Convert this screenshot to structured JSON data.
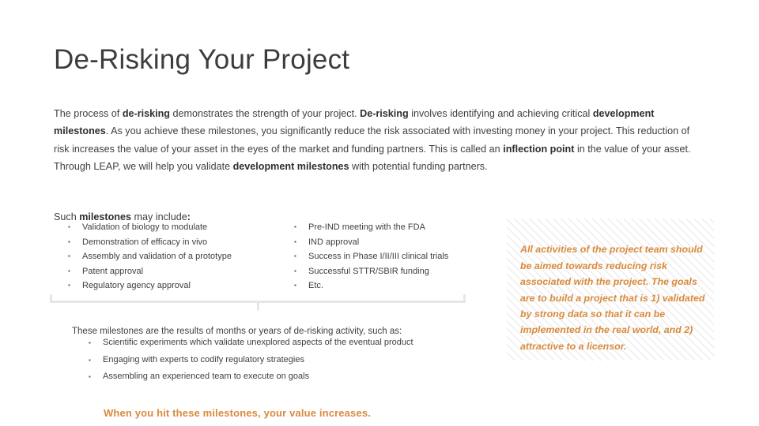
{
  "slide": {
    "title": "De-Risking Your Project",
    "intro": {
      "segments": [
        {
          "text": "The process of ",
          "bold": false
        },
        {
          "text": "de-risking",
          "bold": true
        },
        {
          "text": " demonstrates the strength of your project. ",
          "bold": false
        },
        {
          "text": "De-risking",
          "bold": true
        },
        {
          "text": " involves identifying and achieving critical ",
          "bold": false
        },
        {
          "text": "development milestones",
          "bold": true
        },
        {
          "text": ". As you achieve these milestones, you significantly reduce the risk associated with investing money in your project. This reduction of risk increases the value of your asset in the eyes of the market and funding partners. This is called an ",
          "bold": false
        },
        {
          "text": "inflection point",
          "bold": true
        },
        {
          "text": " in the value of your asset. Through LEAP, we will help you validate ",
          "bold": false
        },
        {
          "text": "development milestones",
          "bold": true
        },
        {
          "text": " with potential funding partners.",
          "bold": false
        }
      ]
    },
    "lead_in": {
      "segments": [
        {
          "text": "Such ",
          "bold": false
        },
        {
          "text": "milestones",
          "bold": true
        },
        {
          "text": " may include",
          "bold": false
        },
        {
          "text": ":",
          "bold": true
        }
      ]
    },
    "bullet_char": "▪",
    "milestones_left": [
      "Validation of biology to modulate",
      "Demonstration of efficacy in vivo",
      "Assembly and validation of a prototype",
      "Patent approval",
      "Regulatory agency approval"
    ],
    "milestones_right": [
      "Pre-IND meeting with the FDA",
      "IND approval",
      "Success in Phase I/II/III clinical trials",
      "Successful STTR/SBIR funding",
      "Etc."
    ],
    "subhead": "These milestones are the results of months or years of de-risking activity, such as:",
    "activities": [
      "Scientific experiments which validate unexplored aspects of the eventual product",
      "Engaging with experts to codify regulatory strategies",
      "Assembling an experienced team to execute on goals"
    ],
    "closing": "When you hit these milestones, your value increases.",
    "callout": "All activities of the project team should be aimed towards reducing risk associated with the project. The goals are to build a project that is 1) validated by strong data so that it can be implemented in the real world, and 2) attractive to a licensor."
  },
  "colors": {
    "accent_orange": "#d98a3d",
    "body_text": "#3f3f3f",
    "bracket_gray": "#e6e6e6"
  }
}
